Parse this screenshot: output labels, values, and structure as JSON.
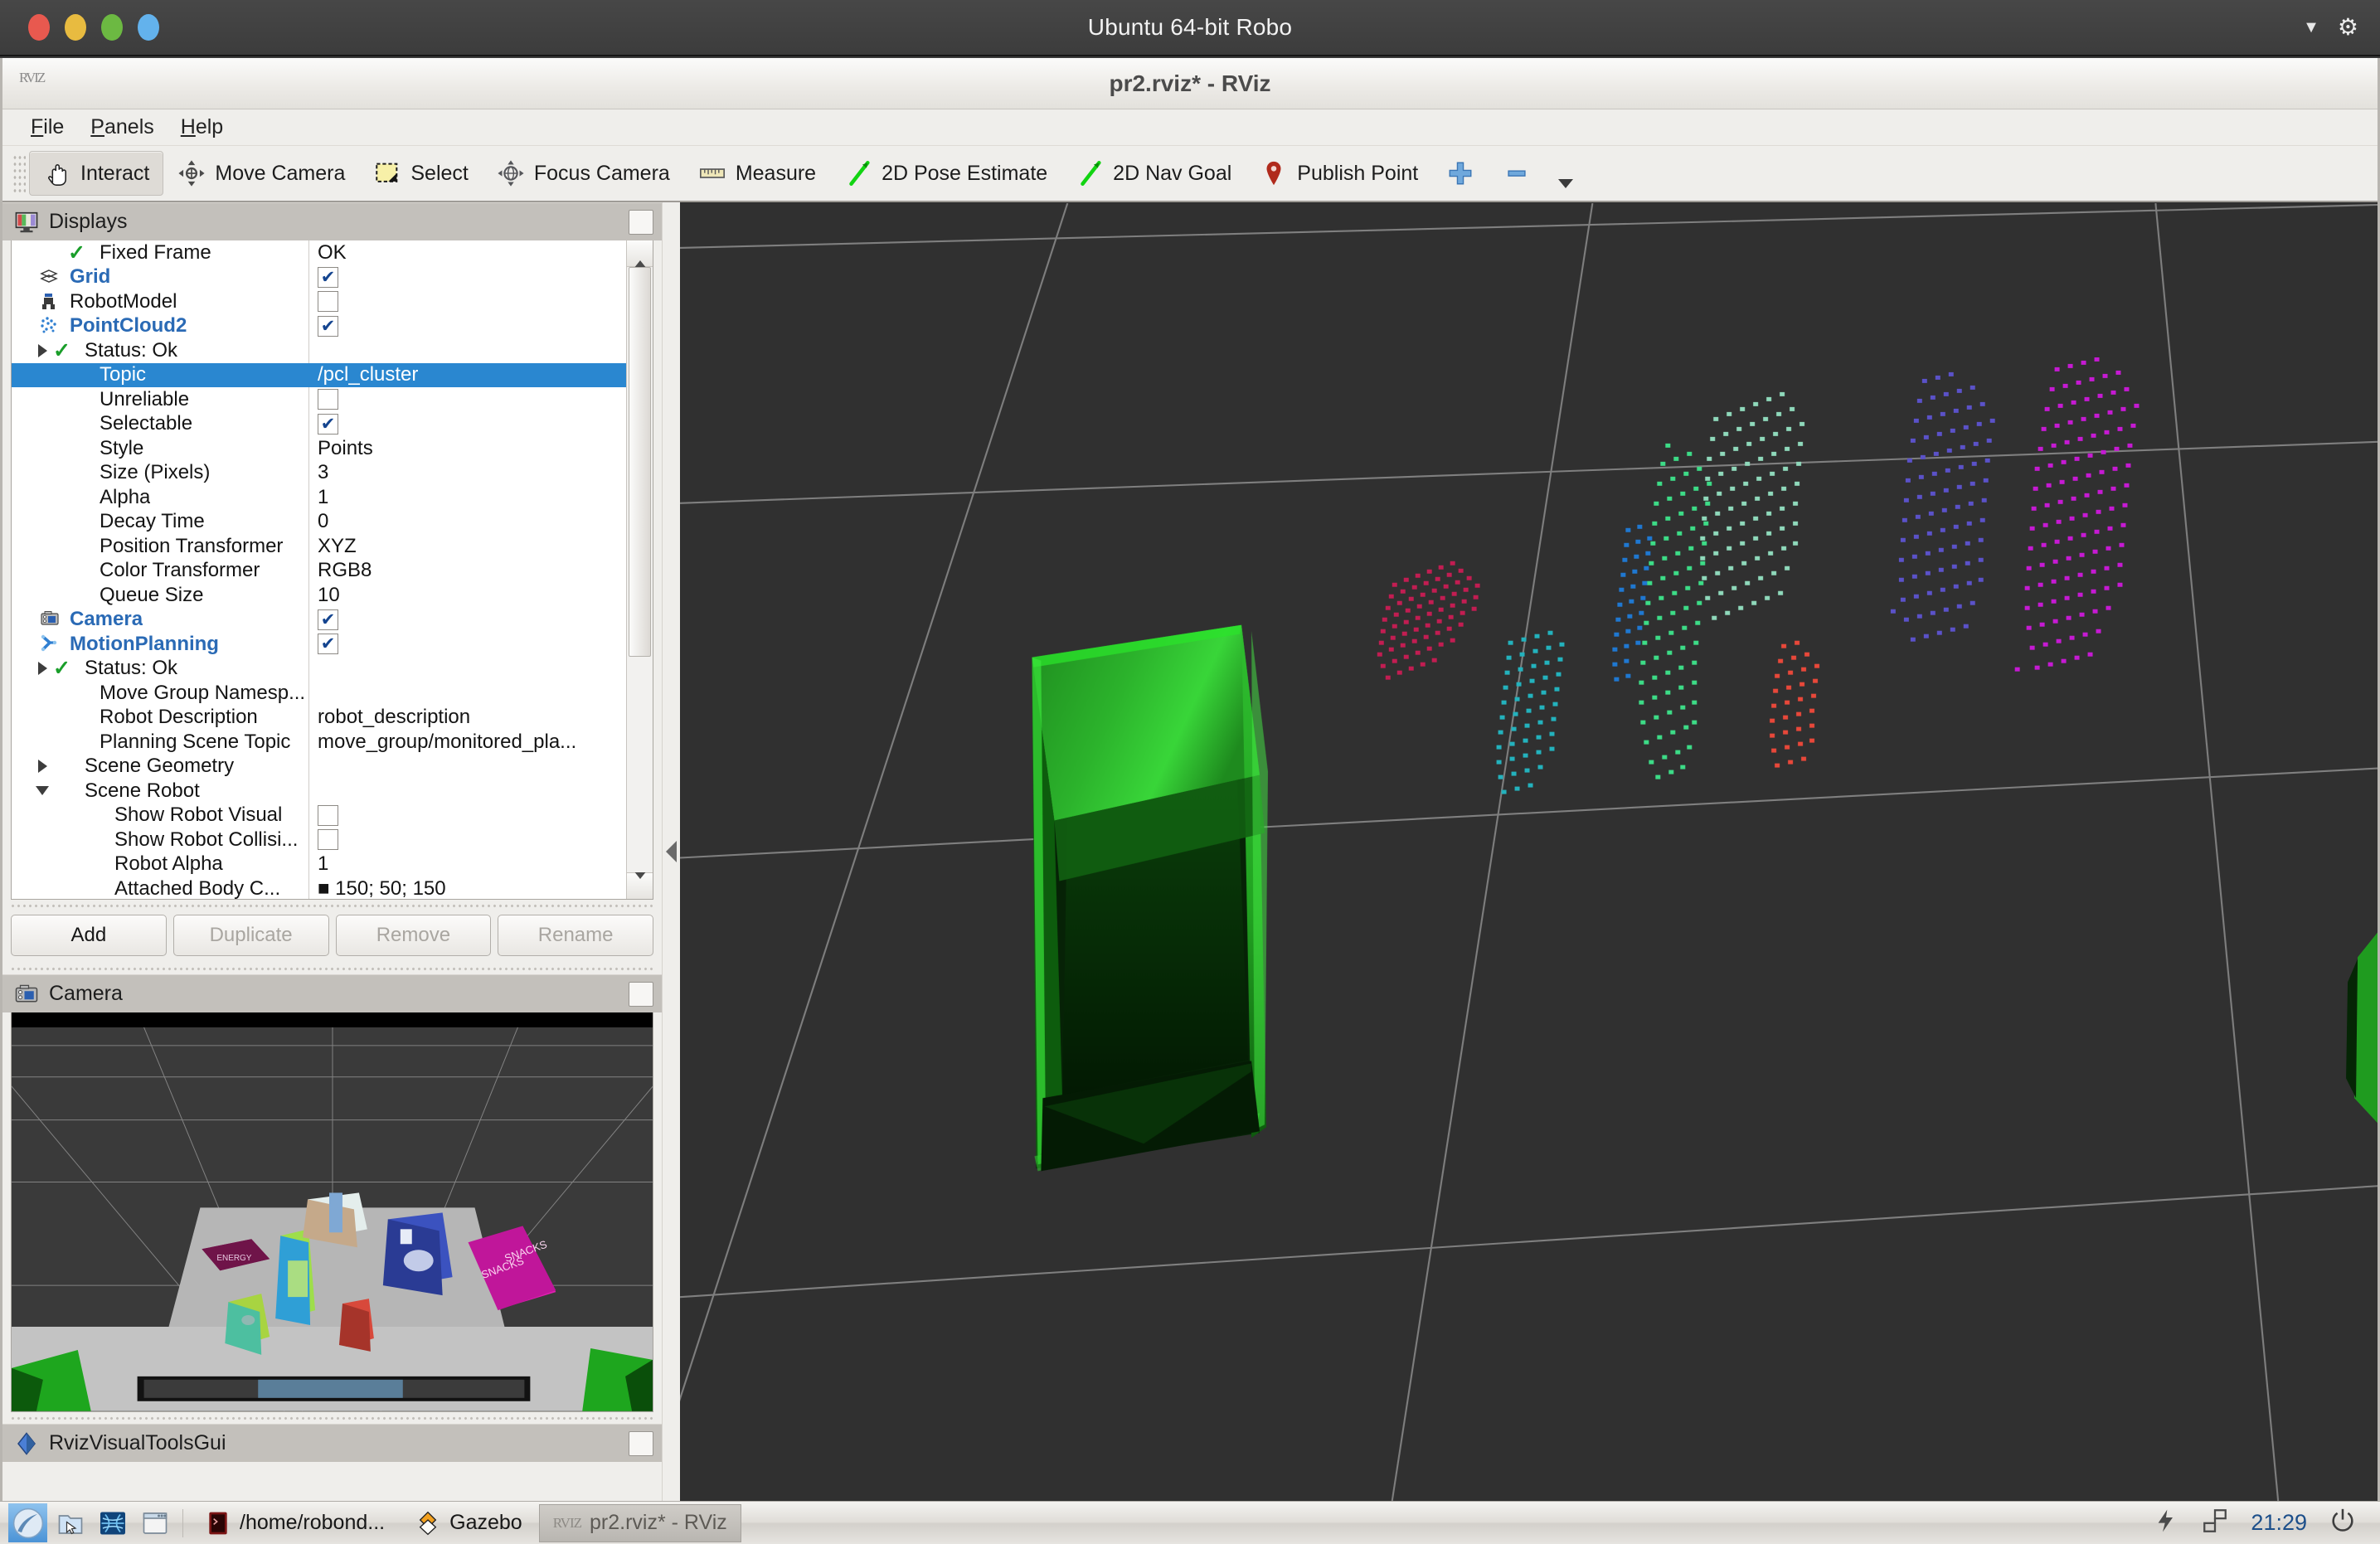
{
  "vm": {
    "title": "Ubuntu 64-bit Robo",
    "caret_icon": "chevron-down-icon",
    "gear_icon": "gear-icon",
    "buttons": [
      "close",
      "minimize",
      "maximize",
      "info"
    ]
  },
  "app": {
    "title": "pr2.rviz* - RViz",
    "icon": "rviz-app-icon"
  },
  "menubar": {
    "items": [
      {
        "label": "File",
        "mnemonic": "F"
      },
      {
        "label": "Panels",
        "mnemonic": "P"
      },
      {
        "label": "Help",
        "mnemonic": "H"
      }
    ]
  },
  "toolbar": {
    "buttons": [
      {
        "label": "Interact",
        "icon": "hand-cursor-icon",
        "active": true
      },
      {
        "label": "Move Camera",
        "icon": "move-camera-icon",
        "active": false
      },
      {
        "label": "Select",
        "icon": "selection-box-icon",
        "active": false
      },
      {
        "label": "Focus Camera",
        "icon": "focus-camera-icon",
        "active": false
      },
      {
        "label": "Measure",
        "icon": "ruler-icon",
        "active": false
      },
      {
        "label": "2D Pose Estimate",
        "icon": "green-arrow-icon",
        "active": false
      },
      {
        "label": "2D Nav Goal",
        "icon": "green-arrow-icon",
        "active": false
      },
      {
        "label": "Publish Point",
        "icon": "map-pin-icon",
        "active": false
      }
    ],
    "extra": [
      {
        "label": "",
        "icon": "plus-icon"
      },
      {
        "label": "",
        "icon": "minus-icon"
      },
      {
        "label": "",
        "icon": "toolbar-overflow-caret-icon"
      }
    ]
  },
  "displays_panel": {
    "title": "Displays",
    "icon": "displays-monitor-icon",
    "float_button": "float-panel-button",
    "rows": [
      {
        "indent": 2,
        "twist": "none",
        "icon": "check-ok-icon",
        "label": "Fixed Frame",
        "value": "OK",
        "vtype": "text",
        "bold": false,
        "selected": false
      },
      {
        "indent": 0,
        "twist": "none",
        "icon": "grid-icon",
        "label": "Grid",
        "value": "checked",
        "vtype": "checkbox",
        "bold": true,
        "selected": false
      },
      {
        "indent": 0,
        "twist": "none",
        "icon": "robot-icon",
        "label": "RobotModel",
        "value": "unchecked",
        "vtype": "checkbox",
        "bold": false,
        "selected": false
      },
      {
        "indent": 0,
        "twist": "none",
        "icon": "pointcloud-icon",
        "label": "PointCloud2",
        "value": "checked",
        "vtype": "checkbox",
        "bold": true,
        "selected": false
      },
      {
        "indent": 1,
        "twist": "closed",
        "icon": "check-ok-icon",
        "label": "Status: Ok",
        "value": "",
        "vtype": "text",
        "bold": false,
        "selected": false
      },
      {
        "indent": 2,
        "twist": "none",
        "icon": "none",
        "label": "Topic",
        "value": "/pcl_cluster",
        "vtype": "text",
        "bold": false,
        "selected": true
      },
      {
        "indent": 2,
        "twist": "none",
        "icon": "none",
        "label": "Unreliable",
        "value": "unchecked",
        "vtype": "checkbox",
        "bold": false,
        "selected": false
      },
      {
        "indent": 2,
        "twist": "none",
        "icon": "none",
        "label": "Selectable",
        "value": "checked",
        "vtype": "checkbox",
        "bold": false,
        "selected": false
      },
      {
        "indent": 2,
        "twist": "none",
        "icon": "none",
        "label": "Style",
        "value": "Points",
        "vtype": "text",
        "bold": false,
        "selected": false
      },
      {
        "indent": 2,
        "twist": "none",
        "icon": "none",
        "label": "Size (Pixels)",
        "value": "3",
        "vtype": "text",
        "bold": false,
        "selected": false
      },
      {
        "indent": 2,
        "twist": "none",
        "icon": "none",
        "label": "Alpha",
        "value": "1",
        "vtype": "text",
        "bold": false,
        "selected": false
      },
      {
        "indent": 2,
        "twist": "none",
        "icon": "none",
        "label": "Decay Time",
        "value": "0",
        "vtype": "text",
        "bold": false,
        "selected": false
      },
      {
        "indent": 2,
        "twist": "none",
        "icon": "none",
        "label": "Position Transformer",
        "value": "XYZ",
        "vtype": "text",
        "bold": false,
        "selected": false
      },
      {
        "indent": 2,
        "twist": "none",
        "icon": "none",
        "label": "Color Transformer",
        "value": "RGB8",
        "vtype": "text",
        "bold": false,
        "selected": false
      },
      {
        "indent": 2,
        "twist": "none",
        "icon": "none",
        "label": "Queue Size",
        "value": "10",
        "vtype": "text",
        "bold": false,
        "selected": false
      },
      {
        "indent": 0,
        "twist": "none",
        "icon": "camera-icon",
        "label": "Camera",
        "value": "checked",
        "vtype": "checkbox",
        "bold": true,
        "selected": false
      },
      {
        "indent": 0,
        "twist": "none",
        "icon": "motionplan-icon",
        "label": "MotionPlanning",
        "value": "checked",
        "vtype": "checkbox",
        "bold": true,
        "selected": false
      },
      {
        "indent": 1,
        "twist": "closed",
        "icon": "check-ok-icon",
        "label": "Status: Ok",
        "value": "",
        "vtype": "text",
        "bold": false,
        "selected": false
      },
      {
        "indent": 2,
        "twist": "none",
        "icon": "none",
        "label": "Move Group Namesp...",
        "value": "",
        "vtype": "text",
        "bold": false,
        "selected": false
      },
      {
        "indent": 2,
        "twist": "none",
        "icon": "none",
        "label": "Robot Description",
        "value": "robot_description",
        "vtype": "text",
        "bold": false,
        "selected": false
      },
      {
        "indent": 2,
        "twist": "none",
        "icon": "none",
        "label": "Planning Scene Topic",
        "value": "move_group/monitored_pla...",
        "vtype": "text",
        "bold": false,
        "selected": false
      },
      {
        "indent": 1,
        "twist": "closed",
        "icon": "none",
        "label": "Scene Geometry",
        "value": "",
        "vtype": "text",
        "bold": false,
        "selected": false
      },
      {
        "indent": 1,
        "twist": "open",
        "icon": "none",
        "label": "Scene Robot",
        "value": "",
        "vtype": "text",
        "bold": false,
        "selected": false
      },
      {
        "indent": 3,
        "twist": "none",
        "icon": "none",
        "label": "Show Robot Visual",
        "value": "unchecked",
        "vtype": "checkbox",
        "bold": false,
        "selected": false
      },
      {
        "indent": 3,
        "twist": "none",
        "icon": "none",
        "label": "Show Robot Collisi...",
        "value": "unchecked",
        "vtype": "checkbox",
        "bold": false,
        "selected": false
      },
      {
        "indent": 3,
        "twist": "none",
        "icon": "none",
        "label": "Robot Alpha",
        "value": "1",
        "vtype": "text",
        "bold": false,
        "selected": false
      },
      {
        "indent": 3,
        "twist": "none",
        "icon": "none",
        "label": "Attached Body C...",
        "value": "■ 150; 50; 150",
        "vtype": "text",
        "bold": false,
        "selected": false
      }
    ],
    "buttons": [
      {
        "label": "Add",
        "enabled": true
      },
      {
        "label": "Duplicate",
        "enabled": false
      },
      {
        "label": "Remove",
        "enabled": false
      },
      {
        "label": "Rename",
        "enabled": false
      }
    ],
    "scrollbar": {
      "up_icon": "scroll-up-icon",
      "down_icon": "scroll-down-icon"
    }
  },
  "camera_panel": {
    "title": "Camera",
    "icon": "camera-icon",
    "float_button": "float-panel-button"
  },
  "rviz_visual_tools_panel": {
    "title": "RvizVisualToolsGui",
    "icon": "blue-diamond-icon",
    "float_button": "float-panel-button"
  },
  "viewport": {
    "background_color": "#303030",
    "grid_color": "#9a9a9a",
    "box_color": "#27a327",
    "clusters": [
      {
        "name": "cluster-crimson",
        "color": "#c21d52"
      },
      {
        "name": "cluster-teal",
        "color": "#23b2bd"
      },
      {
        "name": "cluster-blue",
        "color": "#1f78d1"
      },
      {
        "name": "cluster-springgreen",
        "color": "#3ddc87"
      },
      {
        "name": "cluster-mint",
        "color": "#8fd9bb"
      },
      {
        "name": "cluster-red",
        "color": "#e8483a"
      },
      {
        "name": "cluster-indigo",
        "color": "#5b52c9"
      },
      {
        "name": "cluster-magenta",
        "color": "#c61ad3"
      }
    ]
  },
  "taskbar": {
    "launchers": [
      {
        "name": "show-desktop-icon",
        "selected": true
      },
      {
        "name": "file-manager-icon",
        "selected": false
      },
      {
        "name": "web-browser-icon",
        "selected": false
      },
      {
        "name": "window-list-icon",
        "selected": false
      }
    ],
    "windows": [
      {
        "label": "/home/robond...",
        "icon": "terminal-icon",
        "active": false
      },
      {
        "label": "Gazebo",
        "icon": "gazebo-icon",
        "active": false
      },
      {
        "label": "pr2.rviz* - RViz",
        "icon": "rviz-icon",
        "active": true
      }
    ],
    "tray": [
      {
        "name": "power-bolt-icon"
      },
      {
        "name": "network-icon"
      }
    ],
    "clock": "21:29",
    "power_icon": "power-button-icon"
  }
}
